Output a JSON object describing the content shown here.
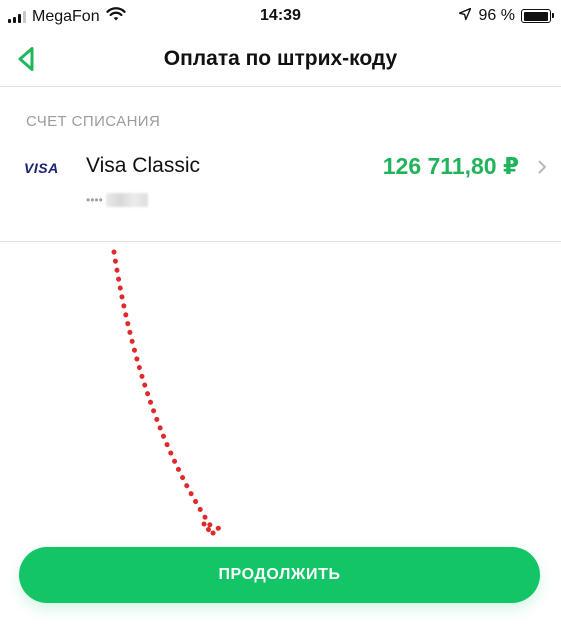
{
  "status_bar": {
    "carrier": "MegaFon",
    "time": "14:39",
    "battery": "96 %",
    "battery_level": 0.96,
    "signal_bars": 3,
    "signal_bars_total": 4
  },
  "nav": {
    "title": "Оплата по штрих-коду",
    "back_icon": "chevron-left-icon",
    "accent_color": "#1fb85e"
  },
  "account": {
    "section_label": "СЧЕТ СПИСАНИЯ",
    "card_brand": "VISA",
    "card_name": "Visa Classic",
    "card_number_mask": "••••",
    "balance": "126 711,80 ₽",
    "balance_color": "#20b35a"
  },
  "actions": {
    "continue_label": "ПРОДОЛЖИТЬ",
    "continue_color": "#14c567"
  }
}
